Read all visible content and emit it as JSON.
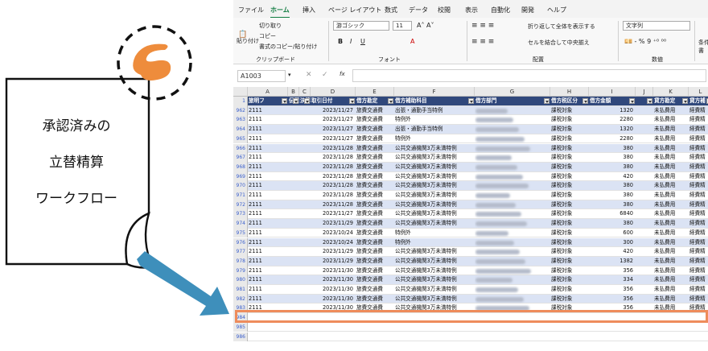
{
  "illustration": {
    "lines": [
      "承認済みの",
      "立替精算",
      "ワークフロー"
    ],
    "logo_color": "#ee8c3c",
    "arrow_color": "#3e8fbb"
  },
  "menu": [
    "ファイル",
    "ホーム",
    "挿入",
    "ページ レイアウト",
    "数式",
    "データ",
    "校閲",
    "表示",
    "自動化",
    "開発",
    "ヘルプ"
  ],
  "menu_active": "ホーム",
  "ribbon": {
    "paste": "貼り付け",
    "cut": "切り取り",
    "copy": "コピー",
    "format_copy": "書式のコピー/貼り付け",
    "clipboard": "クリップボード",
    "font_name": "游ゴシック",
    "font_size": "11",
    "font_group": "フォント",
    "wrap": "折り返して全体を表示する",
    "merge": "セルを結合して中央揃え",
    "align_group": "配置",
    "number_format": "文字列",
    "number_group": "数値",
    "cond": "条件",
    "cond2": "書"
  },
  "formula_bar": {
    "name_box": "A1003",
    "fx": "fx"
  },
  "columns": [
    "A",
    "B",
    "C",
    "D",
    "E",
    "F",
    "G",
    "H",
    "I",
    "J",
    "K",
    "L"
  ],
  "header_row": {
    "num": "1",
    "cells": [
      "旅明フ",
      "伝票",
      "決算",
      "取引日付",
      "借方勘定",
      "借方補助科目",
      "借方部門",
      "借方税区分",
      "借方金額",
      "",
      "貸方勘定",
      "貸方補"
    ]
  },
  "rows": [
    {
      "num": "962",
      "a": "2111",
      "d": "2023/11/27",
      "e": "旅費交通費",
      "f": "出張・通勤手当特例",
      "h": "課税対象",
      "i": "1320",
      "k": "未払費用",
      "l": "経費精"
    },
    {
      "num": "963",
      "a": "2111",
      "d": "2023/11/27",
      "e": "旅費交通費",
      "f": "特例外",
      "h": "課税対象",
      "i": "2280",
      "k": "未払費用",
      "l": "経費精"
    },
    {
      "num": "964",
      "a": "2111",
      "d": "2023/11/27",
      "e": "旅費交通費",
      "f": "出張・通勤手当特例",
      "h": "課税対象",
      "i": "1320",
      "k": "未払費用",
      "l": "経費精"
    },
    {
      "num": "965",
      "a": "2111",
      "d": "2023/11/27",
      "e": "旅費交通費",
      "f": "特例外",
      "h": "課税対象",
      "i": "2280",
      "k": "未払費用",
      "l": "経費精"
    },
    {
      "num": "966",
      "a": "2111",
      "d": "2023/11/28",
      "e": "旅費交通費",
      "f": "公共交通機関3万未満特例",
      "h": "課税対象",
      "i": "380",
      "k": "未払費用",
      "l": "経費精"
    },
    {
      "num": "967",
      "a": "2111",
      "d": "2023/11/28",
      "e": "旅費交通費",
      "f": "公共交通機関3万未満特例",
      "h": "課税対象",
      "i": "380",
      "k": "未払費用",
      "l": "経費精"
    },
    {
      "num": "968",
      "a": "2111",
      "d": "2023/11/28",
      "e": "旅費交通費",
      "f": "公共交通機関3万未満特例",
      "h": "課税対象",
      "i": "380",
      "k": "未払費用",
      "l": "経費精"
    },
    {
      "num": "969",
      "a": "2111",
      "d": "2023/11/28",
      "e": "旅費交通費",
      "f": "公共交通機関3万未満特例",
      "h": "課税対象",
      "i": "420",
      "k": "未払費用",
      "l": "経費精"
    },
    {
      "num": "970",
      "a": "2111",
      "d": "2023/11/28",
      "e": "旅費交通費",
      "f": "公共交通機関3万未満特例",
      "h": "課税対象",
      "i": "380",
      "k": "未払費用",
      "l": "経費精"
    },
    {
      "num": "971",
      "a": "2111",
      "d": "2023/11/28",
      "e": "旅費交通費",
      "f": "公共交通機関3万未満特例",
      "h": "課税対象",
      "i": "380",
      "k": "未払費用",
      "l": "経費精"
    },
    {
      "num": "972",
      "a": "2111",
      "d": "2023/11/28",
      "e": "旅費交通費",
      "f": "公共交通機関3万未満特例",
      "h": "課税対象",
      "i": "380",
      "k": "未払費用",
      "l": "経費精"
    },
    {
      "num": "973",
      "a": "2111",
      "d": "2023/11/27",
      "e": "旅費交通費",
      "f": "公共交通機関3万未満特例",
      "h": "課税対象",
      "i": "6840",
      "k": "未払費用",
      "l": "経費精"
    },
    {
      "num": "974",
      "a": "2111",
      "d": "2023/11/29",
      "e": "旅費交通費",
      "f": "公共交通機関3万未満特例",
      "h": "課税対象",
      "i": "380",
      "k": "未払費用",
      "l": "経費精"
    },
    {
      "num": "975",
      "a": "2111",
      "d": "2023/10/24",
      "e": "旅費交通費",
      "f": "特例外",
      "h": "課税対象",
      "i": "600",
      "k": "未払費用",
      "l": "経費精"
    },
    {
      "num": "976",
      "a": "2111",
      "d": "2023/10/24",
      "e": "旅費交通費",
      "f": "特例外",
      "h": "課税対象",
      "i": "300",
      "k": "未払費用",
      "l": "経費精"
    },
    {
      "num": "977",
      "a": "2111",
      "d": "2023/11/29",
      "e": "旅費交通費",
      "f": "公共交通機関3万未満特例",
      "h": "課税対象",
      "i": "420",
      "k": "未払費用",
      "l": "経費精"
    },
    {
      "num": "978",
      "a": "2111",
      "d": "2023/11/29",
      "e": "旅費交通費",
      "f": "公共交通機関3万未満特例",
      "h": "課税対象",
      "i": "1382",
      "k": "未払費用",
      "l": "経費精"
    },
    {
      "num": "979",
      "a": "2111",
      "d": "2023/11/30",
      "e": "旅費交通費",
      "f": "公共交通機関3万未満特例",
      "h": "課税対象",
      "i": "356",
      "k": "未払費用",
      "l": "経費精"
    },
    {
      "num": "980",
      "a": "2111",
      "d": "2023/11/30",
      "e": "旅費交通費",
      "f": "公共交通機関3万未満特例",
      "h": "課税対象",
      "i": "334",
      "k": "未払費用",
      "l": "経費精"
    },
    {
      "num": "981",
      "a": "2111",
      "d": "2023/11/30",
      "e": "旅費交通費",
      "f": "公共交通機関3万未満特例",
      "h": "課税対象",
      "i": "356",
      "k": "未払費用",
      "l": "経費精"
    },
    {
      "num": "982",
      "a": "2111",
      "d": "2023/11/30",
      "e": "旅費交通費",
      "f": "公共交通機関3万未満特例",
      "h": "課税対象",
      "i": "356",
      "k": "未払費用",
      "l": "経費精"
    },
    {
      "num": "983",
      "a": "2111",
      "d": "2023/11/30",
      "e": "旅費交通費",
      "f": "公共交通機関3万未満特例",
      "h": "課税対象",
      "i": "356",
      "k": "未払費用",
      "l": "経費精"
    }
  ],
  "empty_rows": [
    "984",
    "985",
    "986"
  ],
  "highlight_color": "#ee8c5c",
  "header_color": "#30487c",
  "band_color": "#dbe3f4"
}
